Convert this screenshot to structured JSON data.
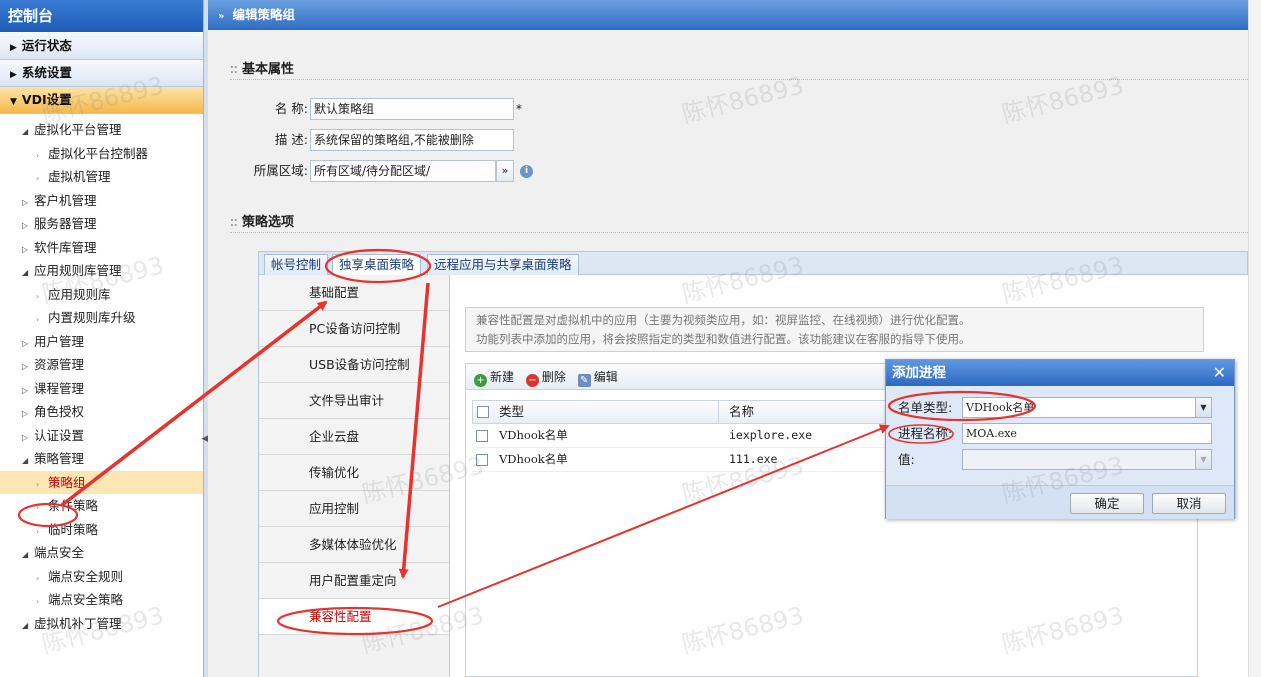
{
  "sidebar": {
    "title": "控制台",
    "sections": [
      "运行状态",
      "系统设置",
      "VDI设置"
    ],
    "tree": [
      {
        "label": "虚拟化平台管理",
        "level": 1,
        "expanded": true
      },
      {
        "label": "虚拟化平台控制器",
        "level": 2
      },
      {
        "label": "虚拟机管理",
        "level": 2
      },
      {
        "label": "客户机管理",
        "level": 1
      },
      {
        "label": "服务器管理",
        "level": 1
      },
      {
        "label": "软件库管理",
        "level": 1
      },
      {
        "label": "应用规则库管理",
        "level": 1,
        "expanded": true
      },
      {
        "label": "应用规则库",
        "level": 2
      },
      {
        "label": "内置规则库升级",
        "level": 2
      },
      {
        "label": "用户管理",
        "level": 1
      },
      {
        "label": "资源管理",
        "level": 1
      },
      {
        "label": "课程管理",
        "level": 1
      },
      {
        "label": "角色授权",
        "level": 1
      },
      {
        "label": "认证设置",
        "level": 1
      },
      {
        "label": "策略管理",
        "level": 1,
        "expanded": true
      },
      {
        "label": "策略组",
        "level": 2,
        "selected": true
      },
      {
        "label": "条件策略",
        "level": 2
      },
      {
        "label": "临时策略",
        "level": 2
      },
      {
        "label": "端点安全",
        "level": 1,
        "expanded": true
      },
      {
        "label": "端点安全规则",
        "level": 2
      },
      {
        "label": "端点安全策略",
        "level": 2
      },
      {
        "label": "虚拟机补丁管理",
        "level": 1,
        "expanded": true
      }
    ]
  },
  "main": {
    "title": "编辑策略组",
    "basic": {
      "heading": "基本属性",
      "name_label": "名 称:",
      "name_value": "默认策略组",
      "required_mark": "*",
      "desc_label": "描 述:",
      "desc_value": "系统保留的策略组,不能被删除",
      "area_label": "所属区域:",
      "area_value": "所有区域/待分配区域/",
      "area_btn": "»"
    },
    "policy": {
      "heading": "策略选项",
      "tabs": [
        "帐号控制",
        "独享桌面策略",
        "远程应用与共享桌面策略"
      ],
      "active_tab": 1,
      "submenu": [
        "基础配置",
        "PC设备访问控制",
        "USB设备访问控制",
        "文件导出审计",
        "企业云盘",
        "传输优化",
        "应用控制",
        "多媒体体验优化",
        "用户配置重定向",
        "兼容性配置"
      ],
      "active_sub": 9,
      "info_line1": "兼容性配置是对虚拟机中的应用（主要为视频类应用，如：视屏监控、在线视频）进行优化配置。",
      "info_line2": "功能列表中添加的应用，将会按照指定的类型和数值进行配置。该功能建议在客服的指导下使用。",
      "toolbar": {
        "new": "新建",
        "delete": "删除",
        "edit": "编辑"
      },
      "columns": [
        "类型",
        "名称"
      ],
      "rows": [
        {
          "type": "VDhook名单",
          "name": "iexplore.exe"
        },
        {
          "type": "VDhook名单",
          "name": "111.exe"
        }
      ]
    }
  },
  "dialog": {
    "title": "添加进程",
    "close": "✕",
    "type_label": "名单类型:",
    "type_value": "VDHook名单",
    "proc_label": "进程名称:",
    "proc_value": "MOA.exe",
    "val_label": "值:",
    "val_value": "",
    "ok": "确定",
    "cancel": "取消"
  },
  "watermark": "陈怀86893",
  "colors": {
    "accent": "#2f6cc3",
    "annotation": "#e8322e",
    "selected_bg": "#fce6b4"
  }
}
